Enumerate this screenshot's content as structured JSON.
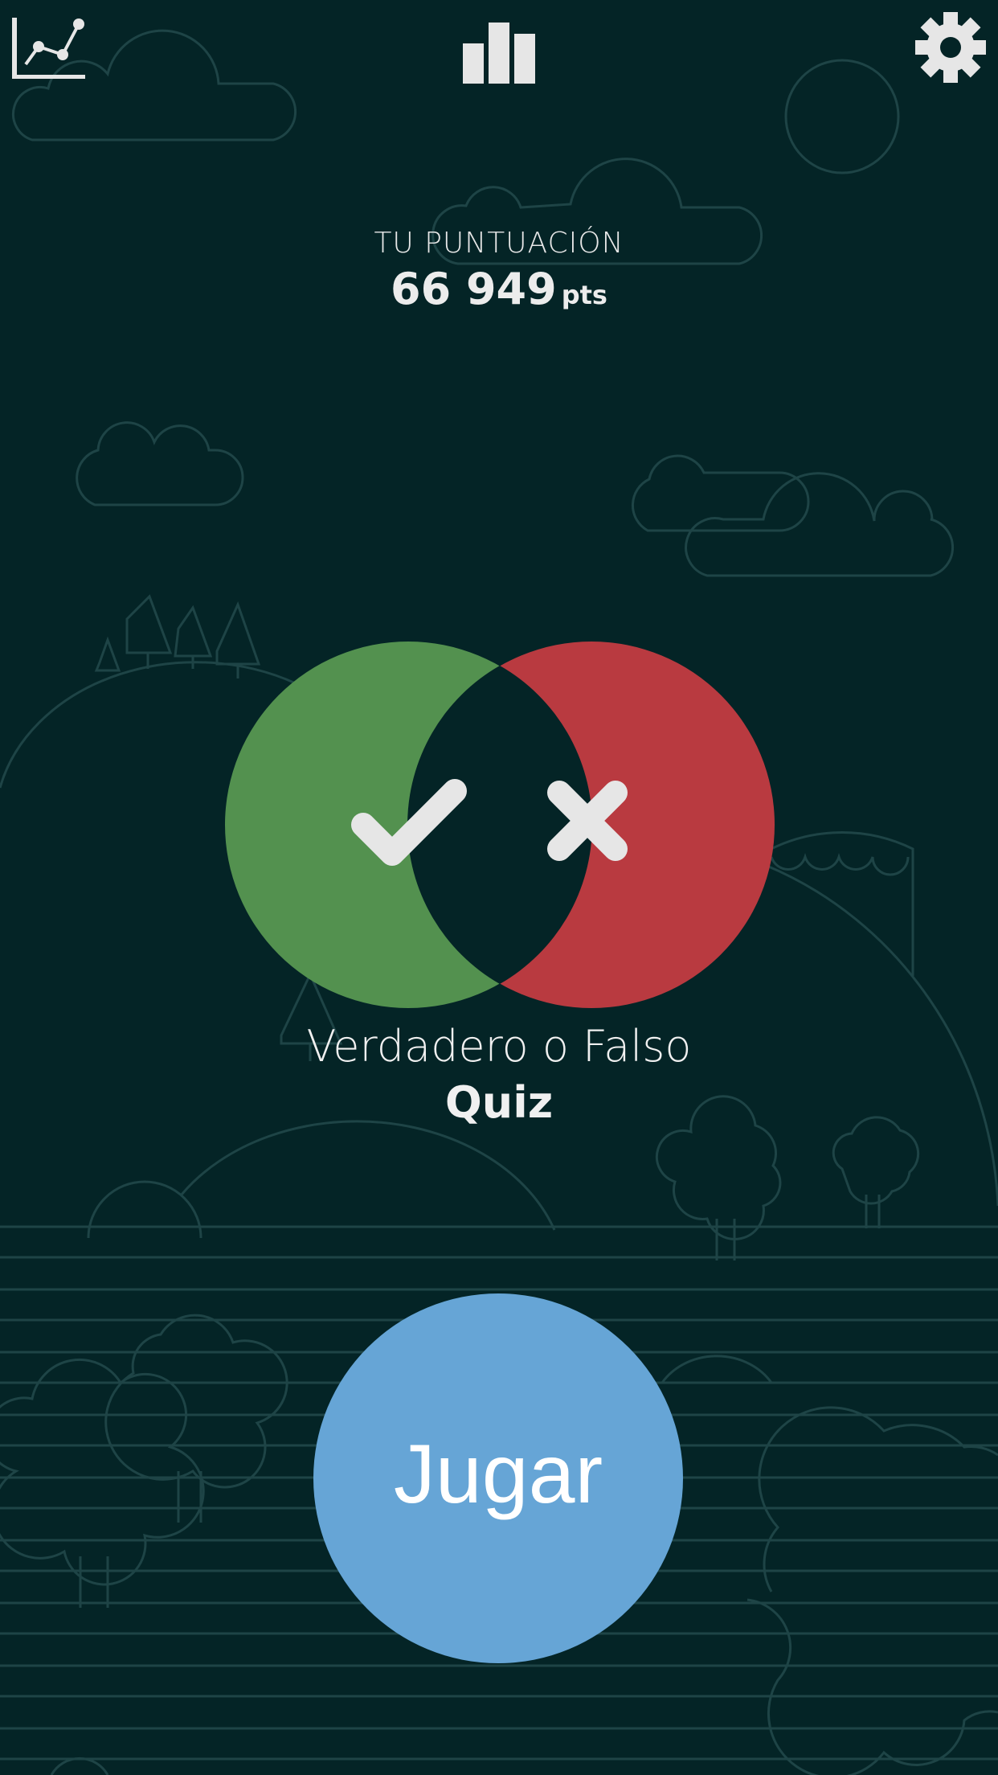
{
  "header": {
    "stats_icon": "line-chart-icon",
    "ranking_icon": "bar-chart-icon",
    "settings_icon": "gear-icon"
  },
  "score": {
    "label": "TU PUNTUACIÓN",
    "value": "66 949",
    "unit": "pts"
  },
  "game": {
    "title": "Verdadero o Falso",
    "subtitle": "Quiz",
    "true_icon": "check-icon",
    "false_icon": "cross-icon"
  },
  "play_button": {
    "label": "Jugar"
  },
  "colors": {
    "background": "#042426",
    "true_green": "#53914f",
    "false_red": "#b93a40",
    "play_blue": "#66a5d6",
    "icon_gray": "#e6e6e6",
    "outline": "#1e4446"
  }
}
